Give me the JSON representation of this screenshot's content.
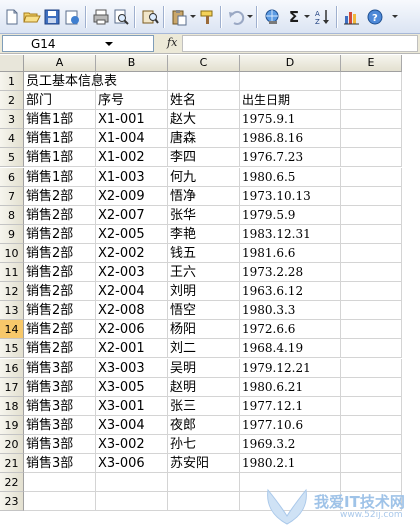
{
  "toolbar": {
    "buttons": [
      {
        "name": "new-document-icon"
      },
      {
        "name": "open-folder-icon"
      },
      {
        "name": "save-icon"
      },
      {
        "name": "permission-icon"
      },
      {
        "name": "print-icon"
      },
      {
        "name": "print-preview-icon"
      },
      {
        "name": "research-icon"
      },
      {
        "name": "paste-icon"
      },
      {
        "name": "format-painter-icon"
      },
      {
        "name": "undo-icon"
      },
      {
        "name": "hyperlink-icon"
      },
      {
        "name": "autosum-icon",
        "glyph": "Σ"
      },
      {
        "name": "sort-ascending-icon"
      },
      {
        "name": "chart-wizard-icon"
      },
      {
        "name": "help-icon"
      }
    ]
  },
  "formula_bar": {
    "name_box": "G14",
    "fx_label": "fx",
    "formula": ""
  },
  "sheet": {
    "columns": [
      "A",
      "B",
      "C",
      "D",
      "E"
    ],
    "row_numbers": [
      "1",
      "2",
      "3",
      "4",
      "5",
      "6",
      "7",
      "8",
      "9",
      "10",
      "11",
      "12",
      "13",
      "14",
      "15",
      "16",
      "17",
      "18",
      "19",
      "20",
      "21",
      "22",
      "23"
    ],
    "active_row": "14",
    "title": "员工基本信息表",
    "headers": [
      "部门",
      "序号",
      "姓名",
      "出生日期"
    ],
    "rows": [
      [
        "销售1部",
        "X1-001",
        "赵大",
        "1975.9.1"
      ],
      [
        "销售1部",
        "X1-004",
        "唐森",
        "1986.8.16"
      ],
      [
        "销售1部",
        "X1-002",
        "李四",
        "1976.7.23"
      ],
      [
        "销售1部",
        "X1-003",
        "何九",
        "1980.6.5"
      ],
      [
        "销售2部",
        "X2-009",
        "悟净",
        "1973.10.13"
      ],
      [
        "销售2部",
        "X2-007",
        "张华",
        "1979.5.9"
      ],
      [
        "销售2部",
        "X2-005",
        "李艳",
        "1983.12.31"
      ],
      [
        "销售2部",
        "X2-002",
        "钱五",
        "1981.6.6"
      ],
      [
        "销售2部",
        "X2-003",
        "王六",
        "1973.2.28"
      ],
      [
        "销售2部",
        "X2-004",
        "刘明",
        "1963.6.12"
      ],
      [
        "销售2部",
        "X2-008",
        "悟空",
        "1980.3.3"
      ],
      [
        "销售2部",
        "X2-006",
        "杨阳",
        "1972.6.6"
      ],
      [
        "销售2部",
        "X2-001",
        "刘二",
        "1968.4.19"
      ],
      [
        "销售3部",
        "X3-003",
        "吴明",
        "1979.12.21"
      ],
      [
        "销售3部",
        "X3-005",
        "赵明",
        "1980.6.21"
      ],
      [
        "销售3部",
        "X3-001",
        "张三",
        "1977.12.1"
      ],
      [
        "销售3部",
        "X3-004",
        "夜郎",
        "1977.10.6"
      ],
      [
        "销售3部",
        "X3-002",
        "孙七",
        "1969.3.2"
      ],
      [
        "销售3部",
        "X3-006",
        "苏安阳",
        "1980.2.1"
      ]
    ]
  },
  "watermark": {
    "text": "我爱IT技术网",
    "url": "www.52ij.com"
  },
  "colors": {
    "active_row_header": "#f7c86a",
    "gridline": "#d4d4d4",
    "header_bg": "#e8e6da"
  }
}
